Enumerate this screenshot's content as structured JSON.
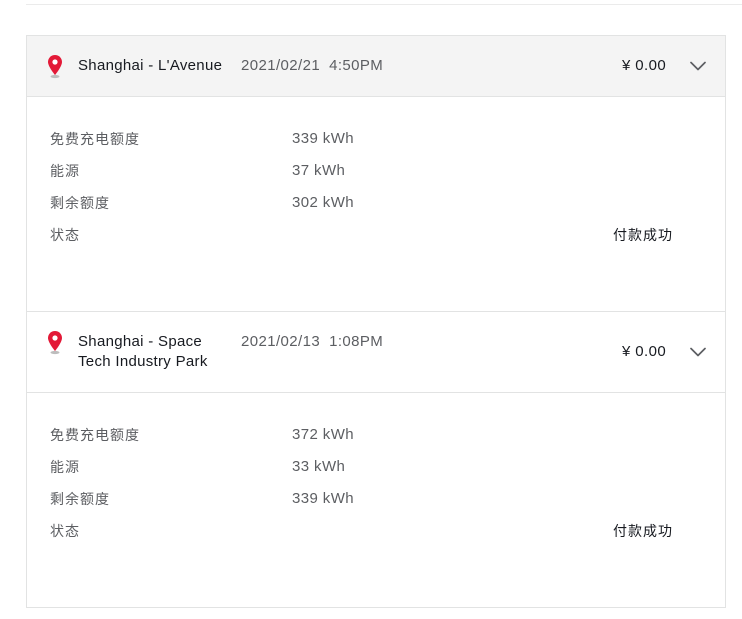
{
  "colors": {
    "pin": "#e31937",
    "header_bg": "#f4f4f4",
    "text_primary": "#171a20",
    "text_secondary": "#5c5e62",
    "border": "#e2e3e3"
  },
  "icons": {
    "location": "location-pin-icon",
    "expand": "chevron-down-icon"
  },
  "transactions": [
    {
      "location": "Shanghai - L'Avenue",
      "date": "2021/02/21",
      "time": "4:50PM",
      "amount": "¥ 0.00",
      "rows": [
        {
          "label": "免费充电额度",
          "value": "339 kWh"
        },
        {
          "label": "能源",
          "value": "37 kWh"
        },
        {
          "label": "剩余额度",
          "value": "302 kWh"
        },
        {
          "label": "状态",
          "value": "付款成功"
        }
      ]
    },
    {
      "location": "Shanghai - Space Tech Industry Park",
      "date": "2021/02/13",
      "time": "1:08PM",
      "amount": "¥ 0.00",
      "rows": [
        {
          "label": "免费充电额度",
          "value": "372 kWh"
        },
        {
          "label": "能源",
          "value": "33 kWh"
        },
        {
          "label": "剩余额度",
          "value": "339 kWh"
        },
        {
          "label": "状态",
          "value": "付款成功"
        }
      ]
    }
  ]
}
